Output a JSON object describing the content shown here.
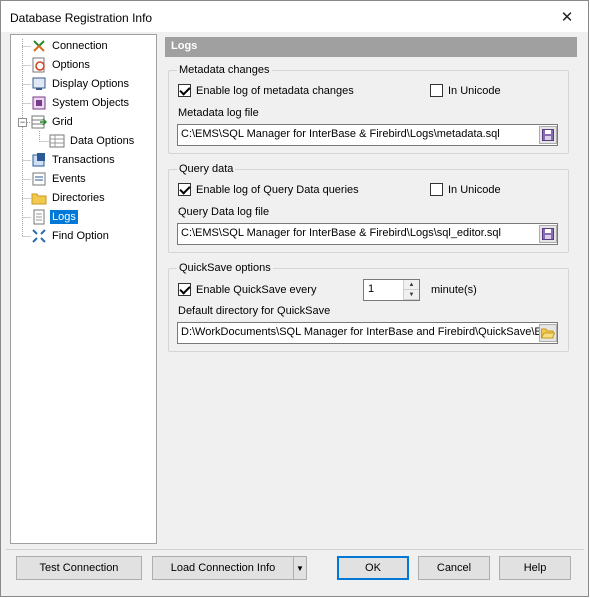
{
  "window": {
    "title": "Database Registration Info",
    "close_glyph": "✕"
  },
  "tree": {
    "items": [
      {
        "label": "Connection",
        "icon": "connection-icon"
      },
      {
        "label": "Options",
        "icon": "options-icon"
      },
      {
        "label": "Display Options",
        "icon": "display-options-icon"
      },
      {
        "label": "System Objects",
        "icon": "system-objects-icon"
      },
      {
        "label": "Grid",
        "icon": "grid-icon",
        "expander": "−"
      },
      {
        "label": "Data Options",
        "icon": "data-options-icon"
      },
      {
        "label": "Transactions",
        "icon": "transactions-icon"
      },
      {
        "label": "Events",
        "icon": "events-icon"
      },
      {
        "label": "Directories",
        "icon": "folder-icon"
      },
      {
        "label": "Logs",
        "icon": "logs-icon",
        "selected": true
      },
      {
        "label": "Find Option",
        "icon": "find-option-icon"
      }
    ]
  },
  "panel": {
    "header": "Logs",
    "metadata": {
      "group_title": "Metadata changes",
      "enable_label": "Enable log of metadata changes",
      "enable_checked": true,
      "unicode_label": "In Unicode",
      "unicode_checked": false,
      "file_label": "Metadata log file",
      "file_value": "C:\\EMS\\SQL Manager for InterBase & Firebird\\Logs\\metadata.sql"
    },
    "query": {
      "group_title": "Query data",
      "enable_label": "Enable log of Query Data queries",
      "enable_checked": true,
      "unicode_label": "In Unicode",
      "unicode_checked": false,
      "file_label": "Query Data log file",
      "file_value": "C:\\EMS\\SQL Manager for InterBase & Firebird\\Logs\\sql_editor.sql"
    },
    "quicksave": {
      "group_title": "QuickSave options",
      "enable_label": "Enable QuickSave every",
      "enable_checked": true,
      "interval_value": "1",
      "interval_unit": "minute(s)",
      "dir_label": "Default directory for QuickSave",
      "dir_value": "D:\\WorkDocuments\\SQL Manager for InterBase and Firebird\\QuickSave\\EM"
    }
  },
  "footer": {
    "test_connection": "Test Connection",
    "load_connection_info": "Load Connection Info",
    "ok": "OK",
    "cancel": "Cancel",
    "help": "Help"
  },
  "colors": {
    "selection": "#0078d7",
    "header_bg": "#a0a0a0",
    "window_bg": "#f0f0f0"
  }
}
